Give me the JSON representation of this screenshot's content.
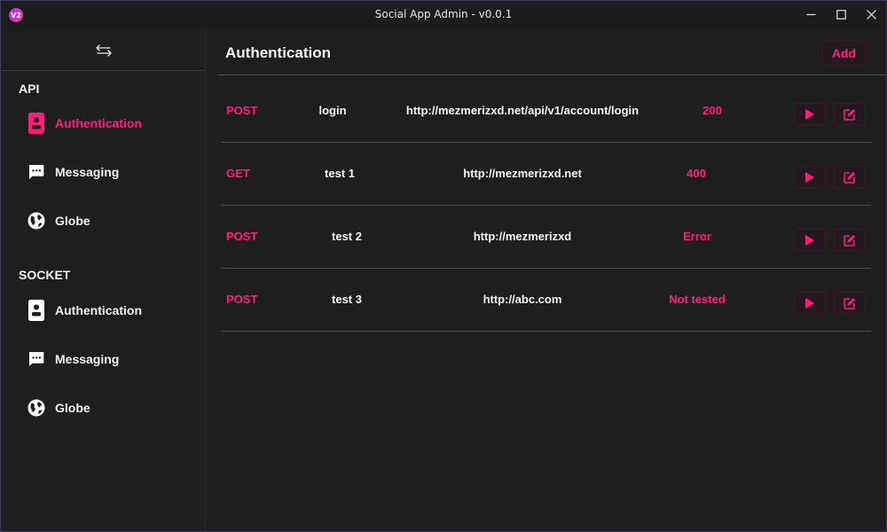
{
  "window": {
    "title": "Social App Admin - v0.0.1",
    "logo_text": "V2"
  },
  "colors": {
    "accent": "#ff1f77",
    "background": "#1e1e1e",
    "text": "#f2f2f2",
    "divider": "#4a4a4a"
  },
  "sidebar": {
    "sections": [
      {
        "label": "API",
        "items": [
          {
            "label": "Authentication",
            "icon": "badge-icon",
            "active": true
          },
          {
            "label": "Messaging",
            "icon": "message-icon",
            "active": false
          },
          {
            "label": "Globe",
            "icon": "globe-icon",
            "active": false
          }
        ]
      },
      {
        "label": "SOCKET",
        "items": [
          {
            "label": "Authentication",
            "icon": "badge-icon",
            "active": false
          },
          {
            "label": "Messaging",
            "icon": "message-icon",
            "active": false
          },
          {
            "label": "Globe",
            "icon": "globe-icon",
            "active": false
          }
        ]
      }
    ]
  },
  "main": {
    "title": "Authentication",
    "add_label": "Add",
    "requests": [
      {
        "method": "POST",
        "name": "login",
        "url": "http://mezmerizxd.net/api/v1/account/login",
        "status": "200"
      },
      {
        "method": "GET",
        "name": "test 1",
        "url": "http://mezmerizxd.net",
        "status": "400"
      },
      {
        "method": "POST",
        "name": "test 2",
        "url": "http://mezmerizxd",
        "status": "Error"
      },
      {
        "method": "POST",
        "name": "test 3",
        "url": "http://abc.com",
        "status": "Not tested"
      }
    ]
  }
}
